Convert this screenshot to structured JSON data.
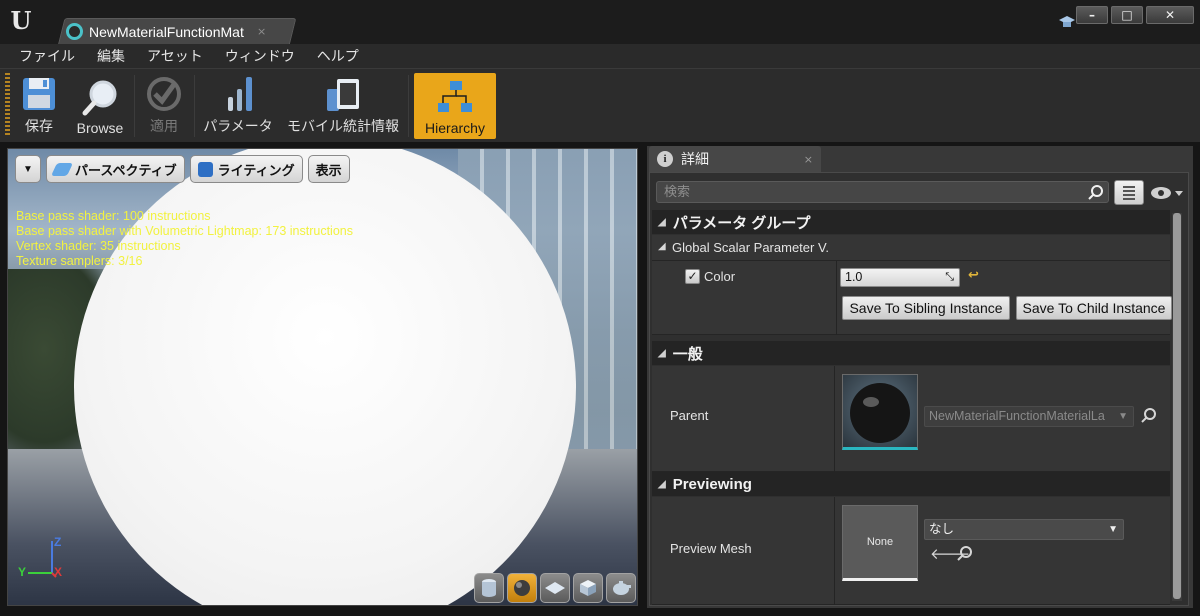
{
  "titlebar": {
    "logo": "U",
    "tab_title": "NewMaterialFunctionMat",
    "tab_close": "×",
    "minimize": "–",
    "maximize": "□",
    "close": "✕"
  },
  "menu": [
    "ファイル",
    "編集",
    "アセット",
    "ウィンドウ",
    "ヘルプ"
  ],
  "toolbar": {
    "save": "保存",
    "browse": "Browse",
    "apply": "適用",
    "parameters": "パラメータ",
    "mobile_stats": "モバイル統計情報",
    "hierarchy": "Hierarchy"
  },
  "viewport": {
    "perspective": "パースペクティブ",
    "lighting": "ライティング",
    "show": "表示",
    "stats": [
      "Base pass shader: 100 instructions",
      "Base pass shader with Volumetric Lightmap: 173 instructions",
      "Vertex shader: 35 instructions",
      "Texture samplers: 3/16"
    ],
    "axis_z": "Z",
    "axis_y": "Y",
    "axis_x": "X"
  },
  "details": {
    "tab_label": "詳細",
    "tab_close": "×",
    "info_glyph": "i",
    "search_placeholder": "検索",
    "parameter_group": {
      "title": "パラメータ グループ",
      "subgroup": "Global Scalar Parameter V.",
      "color_label": "Color",
      "color_value": "1.0",
      "save_sibling": "Save To Sibling Instance",
      "save_child": "Save To Child Instance"
    },
    "general": {
      "title": "一般",
      "parent_label": "Parent",
      "parent_value": "NewMaterialFunctionMaterialLa"
    },
    "previewing": {
      "title": "Previewing",
      "preview_mesh_label": "Preview Mesh",
      "thumb_text": "None",
      "mesh_value": "なし"
    }
  },
  "colors": {
    "accent": "#e9a61a",
    "stats_text": "#f2f240",
    "tab_icon": "#4bc2c9"
  }
}
